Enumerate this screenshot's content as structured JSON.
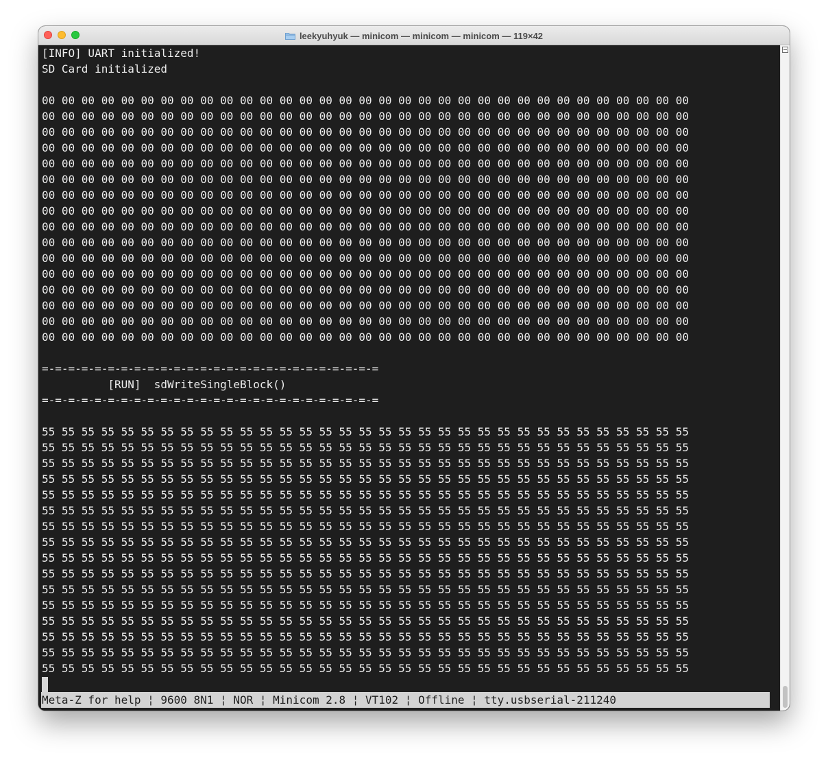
{
  "window": {
    "title": "leekyuhyuk — minicom — minicom — minicom — 119×42"
  },
  "terminal": {
    "lines": [
      "[INFO] UART initialized!",
      "SD Card initialized",
      "",
      "00 00 00 00 00 00 00 00 00 00 00 00 00 00 00 00 00 00 00 00 00 00 00 00 00 00 00 00 00 00 00 00 00",
      "00 00 00 00 00 00 00 00 00 00 00 00 00 00 00 00 00 00 00 00 00 00 00 00 00 00 00 00 00 00 00 00 00",
      "00 00 00 00 00 00 00 00 00 00 00 00 00 00 00 00 00 00 00 00 00 00 00 00 00 00 00 00 00 00 00 00 00",
      "00 00 00 00 00 00 00 00 00 00 00 00 00 00 00 00 00 00 00 00 00 00 00 00 00 00 00 00 00 00 00 00 00",
      "00 00 00 00 00 00 00 00 00 00 00 00 00 00 00 00 00 00 00 00 00 00 00 00 00 00 00 00 00 00 00 00 00",
      "00 00 00 00 00 00 00 00 00 00 00 00 00 00 00 00 00 00 00 00 00 00 00 00 00 00 00 00 00 00 00 00 00",
      "00 00 00 00 00 00 00 00 00 00 00 00 00 00 00 00 00 00 00 00 00 00 00 00 00 00 00 00 00 00 00 00 00",
      "00 00 00 00 00 00 00 00 00 00 00 00 00 00 00 00 00 00 00 00 00 00 00 00 00 00 00 00 00 00 00 00 00",
      "00 00 00 00 00 00 00 00 00 00 00 00 00 00 00 00 00 00 00 00 00 00 00 00 00 00 00 00 00 00 00 00 00",
      "00 00 00 00 00 00 00 00 00 00 00 00 00 00 00 00 00 00 00 00 00 00 00 00 00 00 00 00 00 00 00 00 00",
      "00 00 00 00 00 00 00 00 00 00 00 00 00 00 00 00 00 00 00 00 00 00 00 00 00 00 00 00 00 00 00 00 00",
      "00 00 00 00 00 00 00 00 00 00 00 00 00 00 00 00 00 00 00 00 00 00 00 00 00 00 00 00 00 00 00 00 00",
      "00 00 00 00 00 00 00 00 00 00 00 00 00 00 00 00 00 00 00 00 00 00 00 00 00 00 00 00 00 00 00 00 00",
      "00 00 00 00 00 00 00 00 00 00 00 00 00 00 00 00 00 00 00 00 00 00 00 00 00 00 00 00 00 00 00 00 00",
      "00 00 00 00 00 00 00 00 00 00 00 00 00 00 00 00 00 00 00 00 00 00 00 00 00 00 00 00 00 00 00 00 00",
      "00 00 00 00 00 00 00 00 00 00 00 00 00 00 00 00 00 00 00 00 00 00 00 00 00 00 00 00 00 00 00 00 00",
      "",
      "=-=-=-=-=-=-=-=-=-=-=-=-=-=-=-=-=-=-=-=-=-=-=-=-=-=",
      "          [RUN]  sdWriteSingleBlock()",
      "=-=-=-=-=-=-=-=-=-=-=-=-=-=-=-=-=-=-=-=-=-=-=-=-=-=",
      "",
      "55 55 55 55 55 55 55 55 55 55 55 55 55 55 55 55 55 55 55 55 55 55 55 55 55 55 55 55 55 55 55 55 55",
      "55 55 55 55 55 55 55 55 55 55 55 55 55 55 55 55 55 55 55 55 55 55 55 55 55 55 55 55 55 55 55 55 55",
      "55 55 55 55 55 55 55 55 55 55 55 55 55 55 55 55 55 55 55 55 55 55 55 55 55 55 55 55 55 55 55 55 55",
      "55 55 55 55 55 55 55 55 55 55 55 55 55 55 55 55 55 55 55 55 55 55 55 55 55 55 55 55 55 55 55 55 55",
      "55 55 55 55 55 55 55 55 55 55 55 55 55 55 55 55 55 55 55 55 55 55 55 55 55 55 55 55 55 55 55 55 55",
      "55 55 55 55 55 55 55 55 55 55 55 55 55 55 55 55 55 55 55 55 55 55 55 55 55 55 55 55 55 55 55 55 55",
      "55 55 55 55 55 55 55 55 55 55 55 55 55 55 55 55 55 55 55 55 55 55 55 55 55 55 55 55 55 55 55 55 55",
      "55 55 55 55 55 55 55 55 55 55 55 55 55 55 55 55 55 55 55 55 55 55 55 55 55 55 55 55 55 55 55 55 55",
      "55 55 55 55 55 55 55 55 55 55 55 55 55 55 55 55 55 55 55 55 55 55 55 55 55 55 55 55 55 55 55 55 55",
      "55 55 55 55 55 55 55 55 55 55 55 55 55 55 55 55 55 55 55 55 55 55 55 55 55 55 55 55 55 55 55 55 55",
      "55 55 55 55 55 55 55 55 55 55 55 55 55 55 55 55 55 55 55 55 55 55 55 55 55 55 55 55 55 55 55 55 55",
      "55 55 55 55 55 55 55 55 55 55 55 55 55 55 55 55 55 55 55 55 55 55 55 55 55 55 55 55 55 55 55 55 55",
      "55 55 55 55 55 55 55 55 55 55 55 55 55 55 55 55 55 55 55 55 55 55 55 55 55 55 55 55 55 55 55 55 55",
      "55 55 55 55 55 55 55 55 55 55 55 55 55 55 55 55 55 55 55 55 55 55 55 55 55 55 55 55 55 55 55 55 55",
      "55 55 55 55 55 55 55 55 55 55 55 55 55 55 55 55 55 55 55 55 55 55 55 55 55 55 55 55 55 55 55 55 55",
      "55 55 55 55 55 55 55 55 55 55 55 55 55 55 55 55 55 55 55 55 55 55 55 55 55 55 55 55 55 55 55 55 55"
    ]
  },
  "statusbar": {
    "text": "Meta-Z for help ¦ 9600 8N1 ¦ NOR ¦ Minicom 2.8 ¦ VT102 ¦ Offline ¦ tty.usbserial-211240"
  },
  "icons": {
    "title_icon": "folder-icon"
  },
  "colors": {
    "terminal_bg": "#1e1e1e",
    "terminal_fg": "#ececec",
    "statusbar_bg": "#d3d3d3"
  }
}
